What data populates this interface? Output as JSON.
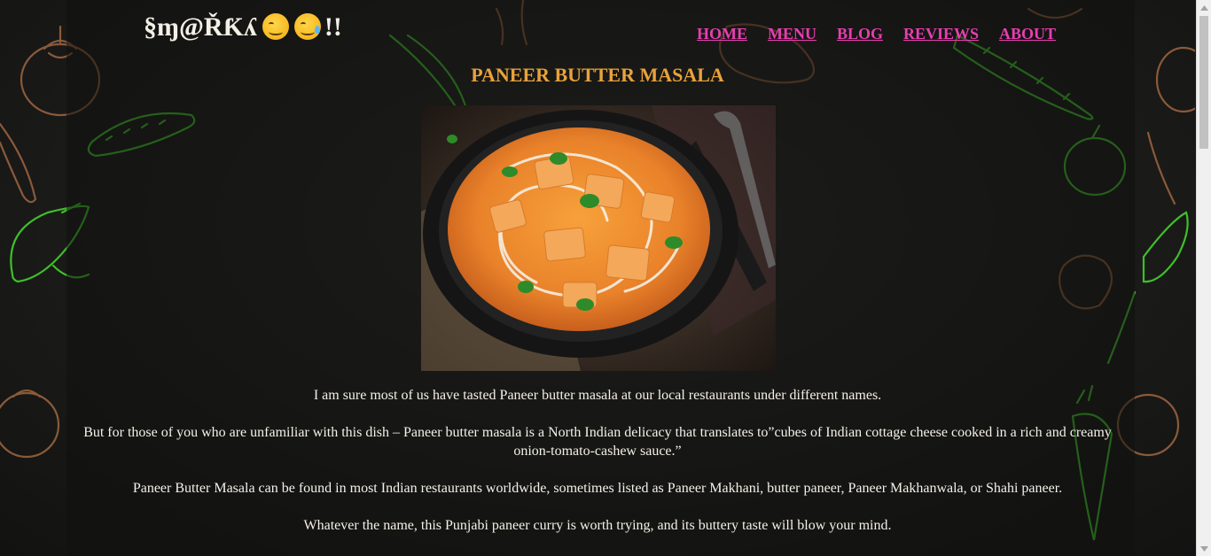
{
  "site": {
    "logo_text": "§ɱ@ŘƘʎ",
    "logo_suffix": "!!"
  },
  "nav": {
    "items": [
      {
        "label": "HOME"
      },
      {
        "label": "MENU"
      },
      {
        "label": "BLOG"
      },
      {
        "label": "REVIEWS"
      },
      {
        "label": "ABOUT"
      }
    ]
  },
  "article": {
    "title": "PANEER BUTTER MASALA",
    "paragraphs": [
      "I am sure most of us have tasted Paneer butter masala at our local restaurants under different names.",
      "But for those of you who are unfamiliar with this dish – Paneer butter masala is a North Indian delicacy that translates to”cubes of Indian cottage cheese cooked in a rich and creamy onion-tomato-cashew sauce.”",
      "Paneer Butter Masala can be found in most Indian restaurants worldwide, sometimes listed as Paneer Makhani, butter paneer, Paneer Makhanwala, or Shahi paneer.",
      "Whatever the name, this Punjabi paneer curry is worth trying, and its buttery taste will blow your mind."
    ]
  },
  "colors": {
    "nav_link": "#e83eb1",
    "title": "#e9a23b",
    "text": "#f4f1e8",
    "background": "#1e1e1c"
  },
  "icons": {
    "logo_emoji": "face-savoring-food-icon",
    "scroll_up": "chevron-up-icon",
    "scroll_down": "chevron-down-icon"
  }
}
